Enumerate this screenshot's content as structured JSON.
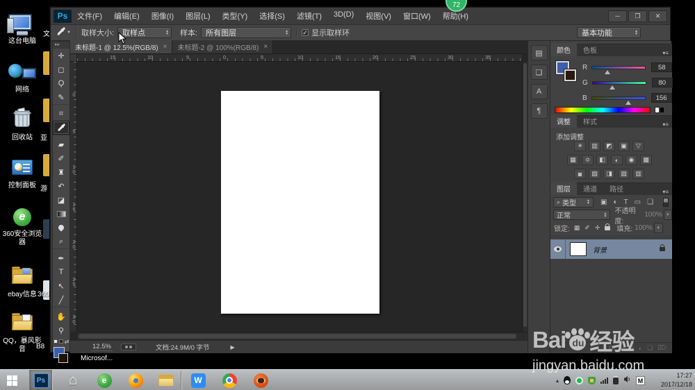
{
  "badge": {
    "value": "72"
  },
  "desktop": {
    "icons": [
      {
        "label": "这台电脑"
      },
      {
        "label": "网络"
      },
      {
        "label": "回收站"
      },
      {
        "label": "控制面板"
      },
      {
        "label": "360安全浏览器"
      },
      {
        "label": "ebay信息"
      },
      {
        "label": "QQ，暴风影音"
      }
    ],
    "partial_labels": [
      "文",
      "亚",
      "游",
      "360",
      "B8"
    ],
    "microsoft_label": "Microsof..."
  },
  "ps": {
    "logo": "Ps",
    "window_controls": {
      "minimize": "─",
      "maximize": "❐",
      "close": "✕"
    },
    "menus": [
      "文件(F)",
      "编辑(E)",
      "图像(I)",
      "图层(L)",
      "类型(Y)",
      "选择(S)",
      "滤镜(T)",
      "3D(D)",
      "视图(V)",
      "窗口(W)",
      "帮助(H)"
    ],
    "options": {
      "sample_size_label": "取样大小:",
      "sample_size_value": "取样点",
      "sample_label": "样本:",
      "sample_value": "所有图层",
      "show_ring_checked": "✓",
      "show_ring_label": "显示取样环",
      "workspace": "基本功能"
    },
    "tabs": [
      {
        "title": "未标题-1 @ 12.5%(RGB/8)",
        "close": "×"
      },
      {
        "title": "未标题-2 @ 100%(RGB/8)",
        "close": "×"
      }
    ],
    "tools": [
      {
        "icon": "move-tool",
        "glyph": "✛"
      },
      {
        "icon": "rectangular-marquee-tool",
        "glyph": "◻"
      },
      {
        "icon": "lasso-tool",
        "glyph": "Ϙ"
      },
      {
        "icon": "quick-selection-tool",
        "glyph": "✎"
      },
      {
        "icon": "crop-tool",
        "glyph": "⌗"
      },
      {
        "icon": "eyedropper-tool",
        "glyph": ""
      },
      {
        "icon": "healing-brush-tool",
        "glyph": "▰"
      },
      {
        "icon": "brush-tool",
        "glyph": "✐"
      },
      {
        "icon": "clone-stamp-tool",
        "glyph": "♜"
      },
      {
        "icon": "history-brush-tool",
        "glyph": "↶"
      },
      {
        "icon": "eraser-tool",
        "glyph": "◪"
      },
      {
        "icon": "gradient-tool",
        "glyph": ""
      },
      {
        "icon": "blur-tool",
        "glyph": ""
      },
      {
        "icon": "dodge-tool",
        "glyph": "⌕"
      },
      {
        "icon": "pen-tool",
        "glyph": "✒"
      },
      {
        "icon": "type-tool",
        "glyph": "T"
      },
      {
        "icon": "path-selection-tool",
        "glyph": "↖"
      },
      {
        "icon": "line-tool",
        "glyph": "╱"
      },
      {
        "icon": "hand-tool",
        "glyph": "✋"
      },
      {
        "icon": "zoom-tool",
        "glyph": "⚲"
      }
    ],
    "dock_panels": [
      {
        "icon": "brush-presets-panel",
        "glyph": "▤"
      },
      {
        "icon": "clone-source-panel",
        "glyph": "❏"
      },
      {
        "icon": "character-panel",
        "glyph": "A"
      },
      {
        "icon": "paragraph-panel",
        "glyph": "¶"
      }
    ],
    "rulers": {
      "horizontal": [
        "15",
        "10",
        "5",
        "0",
        "5",
        "10",
        "15",
        "20",
        "25",
        "30",
        "35"
      ],
      "vertical": [
        "0",
        "5",
        "10",
        "15",
        "20",
        "25",
        "30"
      ]
    },
    "status": {
      "zoom": "12.5%",
      "document_info": "文档:24.9M/0 字节",
      "menu_arrow": "▶"
    },
    "color_panel": {
      "tab_color": "颜色",
      "tab_swatches": "色板",
      "channels": [
        {
          "label": "R",
          "value": "58"
        },
        {
          "label": "G",
          "value": "80"
        },
        {
          "label": "B",
          "value": "156"
        }
      ]
    },
    "adjustments_panel": {
      "tab_adjustments": "调整",
      "tab_styles": "样式",
      "add_adjustment_label": "添加调整",
      "rows": [
        [
          {
            "icon": "brightness-contrast",
            "glyph": "☀"
          },
          {
            "icon": "levels",
            "glyph": "▥"
          },
          {
            "icon": "curves",
            "glyph": "◩"
          },
          {
            "icon": "exposure",
            "glyph": "▣"
          },
          {
            "icon": "vibrance",
            "glyph": "▽"
          }
        ],
        [
          {
            "icon": "hue-saturation",
            "glyph": "▦"
          },
          {
            "icon": "color-balance",
            "glyph": "≎"
          },
          {
            "icon": "black-white",
            "glyph": "◧"
          },
          {
            "icon": "photo-filter",
            "glyph": "◐"
          },
          {
            "icon": "channel-mixer",
            "glyph": "◉"
          },
          {
            "icon": "color-lookup",
            "glyph": "▩"
          }
        ],
        [
          {
            "icon": "invert",
            "glyph": "◙"
          },
          {
            "icon": "posterize",
            "glyph": "▨"
          },
          {
            "icon": "threshold",
            "glyph": "◨"
          },
          {
            "icon": "selective-color",
            "glyph": "▧"
          },
          {
            "icon": "gradient-map",
            "glyph": "▥"
          }
        ]
      ]
    },
    "layers_panel": {
      "tab_layers": "图层",
      "tab_channels": "通道",
      "tab_paths": "路径",
      "filter_search_glyph": "⌕",
      "filter_label": "类型",
      "filter_icons": [
        {
          "icon": "filter-pixel-layers",
          "glyph": "▣"
        },
        {
          "icon": "filter-adjustment-layers",
          "glyph": "◐"
        },
        {
          "icon": "filter-type-layers",
          "glyph": "T"
        },
        {
          "icon": "filter-shape-layers",
          "glyph": "▭"
        },
        {
          "icon": "filter-smart-objects",
          "glyph": "❏"
        }
      ],
      "blend_mode": "正常",
      "opacity_label": "不透明度:",
      "opacity_value": "100%",
      "lock_label": "锁定:",
      "lock_icons": [
        {
          "icon": "lock-transparency",
          "glyph": "▦"
        },
        {
          "icon": "lock-pixels",
          "glyph": "✐"
        },
        {
          "icon": "lock-position",
          "glyph": "✛"
        }
      ],
      "fill_label": "填充:",
      "fill_value": "100%",
      "background_layer_name": "背景"
    }
  },
  "taskbar": {
    "time": "17:27",
    "date": "2017/12/18",
    "ime": "M",
    "tray_arrow": "▴"
  },
  "watermark": {
    "brand_left": "Bai",
    "brand_du": "du",
    "brand_right": "经验",
    "url": "jingyan.baidu.com"
  }
}
